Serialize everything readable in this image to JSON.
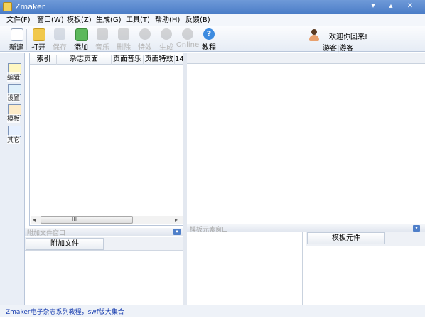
{
  "window": {
    "title": "Zmaker",
    "btn_min": "▾",
    "btn_max": "▴",
    "btn_close": "✕"
  },
  "menu": [
    {
      "label": "文件(F)"
    },
    {
      "label": "窗口(W)"
    },
    {
      "label": "模板(Z)"
    },
    {
      "label": "生成(G)"
    },
    {
      "label": "工具(T)"
    },
    {
      "label": "帮助(H)"
    },
    {
      "label": "反馈(B)"
    }
  ],
  "toolbar": {
    "new": "新建",
    "open": "打开",
    "save": "保存",
    "add": "添加",
    "music": "音乐",
    "delete": "删除",
    "effects": "特效",
    "generate": "生成",
    "online": "Online",
    "tutorial": "教程"
  },
  "user": {
    "welcome": "欢迎你回来!",
    "status": "游客|游客"
  },
  "sidebar": {
    "edit": "编辑",
    "settings": "设置",
    "template": "模板",
    "other": "其它"
  },
  "list": {
    "columns": [
      "索引",
      "杂志页面",
      "页面音乐",
      "页面特效",
      "14"
    ],
    "scroll_left": "◂",
    "scroll_right": "▸",
    "scroll_grip": "III"
  },
  "attach_panel": {
    "title": "附加文件窗口",
    "tab": "附加文件",
    "dropdown": "▾"
  },
  "template_panel": {
    "title": "模板元素窗口",
    "tab": "模板元件",
    "dropdown": "▾"
  },
  "status": {
    "text": "Zmaker电子杂志系列教程，swf版大集合"
  },
  "colors": {
    "titlebar": "#4a7cc7",
    "status_text": "#1a3fb0",
    "accent": "#4f7fc9"
  }
}
